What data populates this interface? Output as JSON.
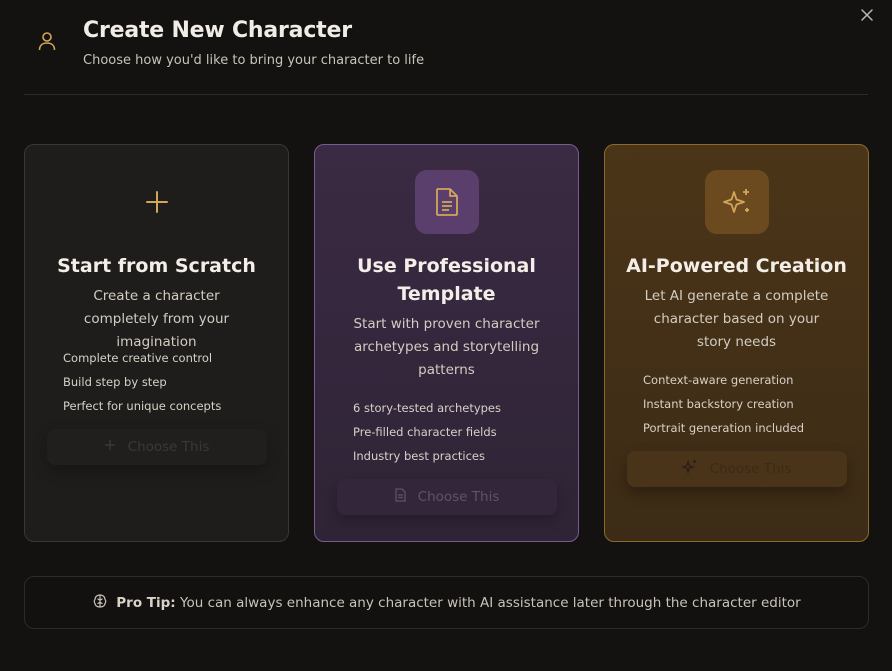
{
  "header": {
    "title": "Create New Character",
    "subtitle": "Choose how you'd like to bring your character to life"
  },
  "cards": [
    {
      "title": "Start from Scratch",
      "description": "Create a character completely from your imagination",
      "features": [
        "Complete creative control",
        "Build step by step",
        "Perfect for unique concepts"
      ],
      "button_label": "Choose This",
      "icon": "plus-icon"
    },
    {
      "title": "Use Professional Template",
      "description": "Start with proven character archetypes and storytelling patterns",
      "features": [
        "6 story-tested archetypes",
        "Pre-filled character fields",
        "Industry best practices"
      ],
      "button_label": "Choose This",
      "icon": "document-icon"
    },
    {
      "title": "AI-Powered Creation",
      "description": "Let AI generate a complete character based on your story needs",
      "features": [
        "Context-aware generation",
        "Instant backstory creation",
        "Portrait generation included"
      ],
      "button_label": "Choose This",
      "icon": "sparkles-icon"
    }
  ],
  "tip": {
    "label": "Pro Tip:",
    "text": "You can always enhance any character with AI assistance later through the character editor"
  },
  "colors": {
    "accent_gold": "#d4a55a",
    "template_border": "#7a5a93",
    "ai_border": "#8c6a2e"
  }
}
